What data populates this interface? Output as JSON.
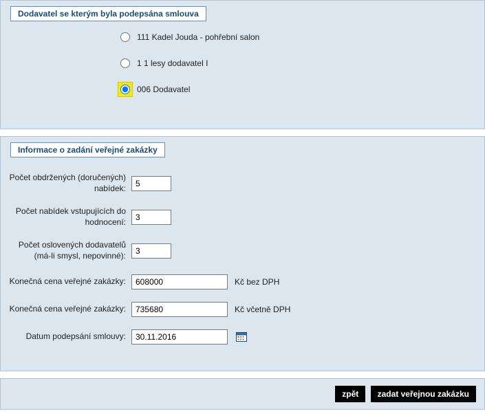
{
  "section1": {
    "legend": "Dodavatel se kterým byla podepsána smlouva",
    "options": [
      {
        "label": "111 Kadel Jouda - pohřební salon",
        "selected": false
      },
      {
        "label": "1 1 lesy dodavatel I",
        "selected": false
      },
      {
        "label": "006 Dodavatel",
        "selected": true
      }
    ]
  },
  "section2": {
    "legend": "Informace o zadání veřejné zakázky",
    "fields": {
      "offers_received": {
        "label": "Počet obdržených (doručených) nabídek:",
        "value": "5"
      },
      "offers_evaluated": {
        "label": "Počet nabídek vstupujících do hodnocení:",
        "value": "3"
      },
      "suppliers_addressed": {
        "label": "Počet oslovených dodavatelů (má-li smysl, nepovinné):",
        "value": "3"
      },
      "price_no_vat": {
        "label": "Konečná cena veřejné zakázky:",
        "value": "608000",
        "suffix": "Kč bez DPH"
      },
      "price_with_vat": {
        "label": "Konečná cena veřejné zakázky:",
        "value": "735680",
        "suffix": "Kč včetně DPH"
      },
      "sign_date": {
        "label": "Datum podepsání smlouvy:",
        "value": "30.11.2016"
      }
    }
  },
  "buttons": {
    "back": "zpět",
    "submit": "zadat veřejnou zakázku"
  }
}
